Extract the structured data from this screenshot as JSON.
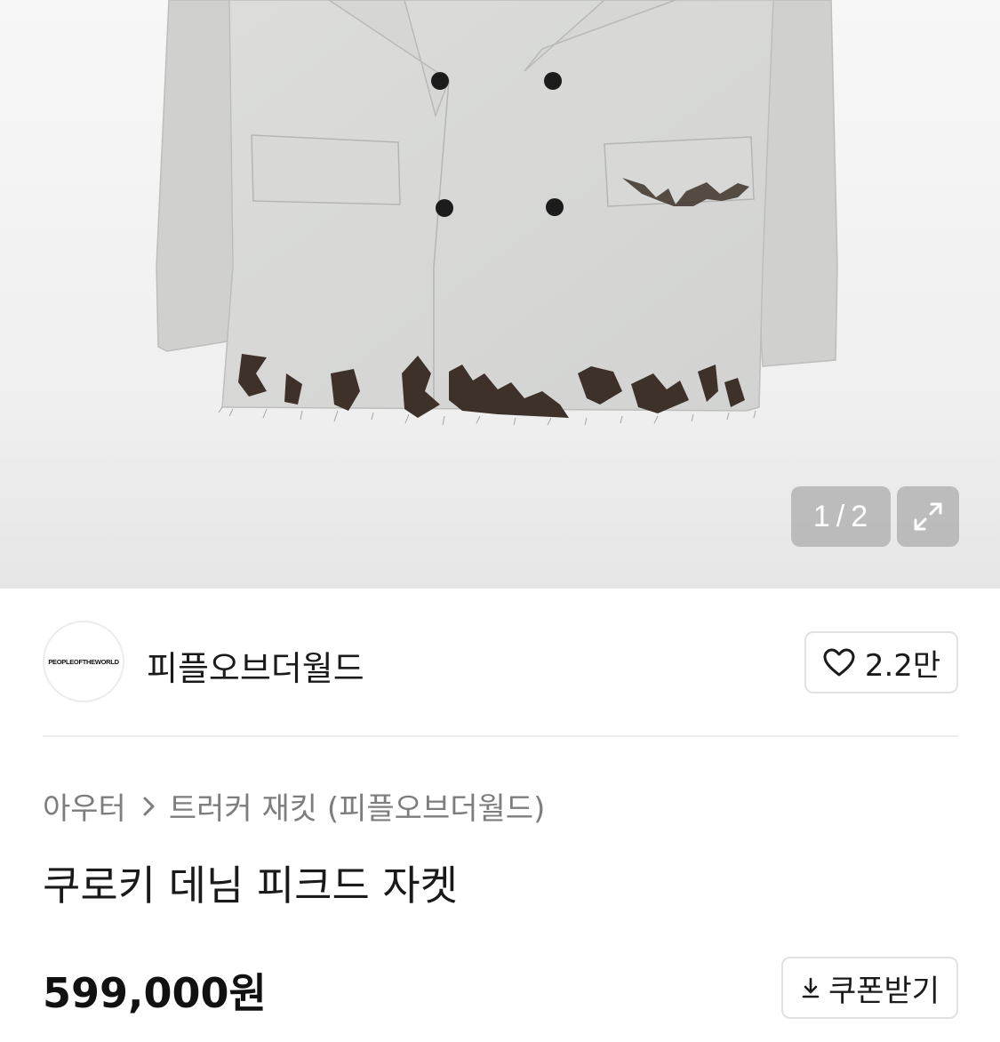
{
  "gallery": {
    "counter_current": "1",
    "counter_separator": "/",
    "counter_total": "2",
    "expand_icon": "expand-icon"
  },
  "brand": {
    "logo_text": "PEOPLEOFTHEWORLD",
    "name": "피플오브더월드"
  },
  "like": {
    "icon": "heart-icon",
    "count": "2.2만"
  },
  "breadcrumb": {
    "category": "아우터",
    "subcategory": "트러커 재킷 (피플오브더월드)"
  },
  "product": {
    "title": "쿠로키 데님 피크드 자켓",
    "price": "599,000원"
  },
  "coupon": {
    "icon": "download-icon",
    "label": "쿠폰받기"
  },
  "colors": {
    "jacket": "#d9dad8",
    "button": "#1c1c1c",
    "distress": "#3d3129",
    "overlay": "#969696"
  }
}
